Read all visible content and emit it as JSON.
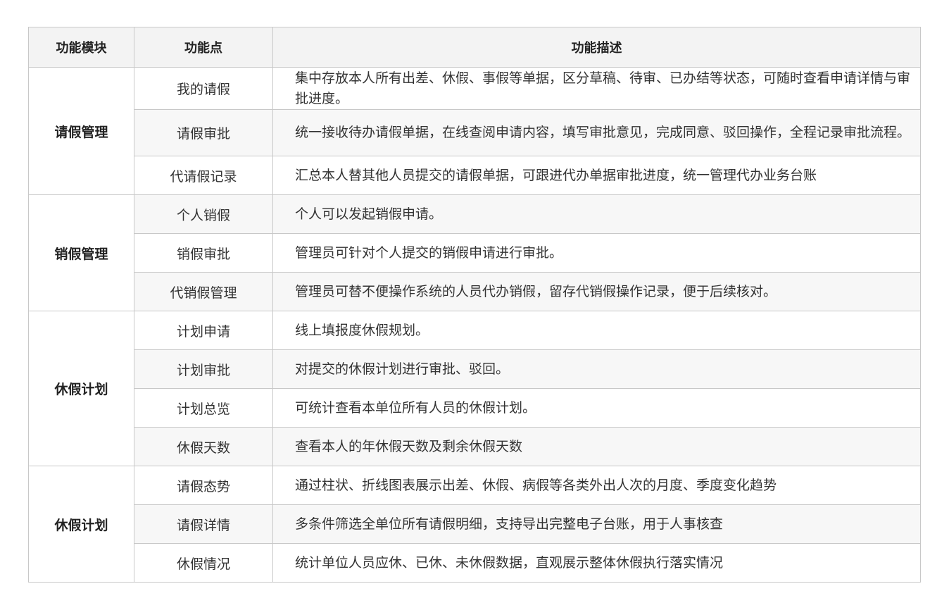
{
  "table": {
    "headers": [
      "功能模块",
      "功能点",
      "功能描述"
    ],
    "groups": [
      {
        "module": "请假管理",
        "rows": [
          {
            "point": "我的请假",
            "desc": "集中存放本人所有出差、休假、事假等单据，区分草稿、待审、已办结等状态，可随时查看申请详情与审批进度。"
          },
          {
            "point": "请假审批",
            "desc": "统一接收待办请假单据，在线查阅申请内容，填写审批意见，完成同意、驳回操作，全程记录审批流程。"
          },
          {
            "point": "代请假记录",
            "desc": "汇总本人替其他人员提交的请假单据，可跟进代办单据审批进度，统一管理代办业务台账"
          }
        ]
      },
      {
        "module": "销假管理",
        "rows": [
          {
            "point": "个人销假",
            "desc": "个人可以发起销假申请。"
          },
          {
            "point": "销假审批",
            "desc": "管理员可针对个人提交的销假申请进行审批。"
          },
          {
            "point": "代销假管理",
            "desc": "管理员可替不便操作系统的人员代办销假，留存代销假操作记录，便于后续核对。"
          }
        ]
      },
      {
        "module": "休假计划",
        "rows": [
          {
            "point": "计划申请",
            "desc": "线上填报度休假规划。"
          },
          {
            "point": "计划审批",
            "desc": "对提交的休假计划进行审批、驳回。"
          },
          {
            "point": "计划总览",
            "desc": "可统计查看本单位所有人员的休假计划。"
          },
          {
            "point": "休假天数",
            "desc": "查看本人的年休假天数及剩余休假天数"
          }
        ]
      },
      {
        "module": "休假计划",
        "rows": [
          {
            "point": "请假态势",
            "desc": "通过柱状、折线图表展示出差、休假、病假等各类外出人次的月度、季度变化趋势"
          },
          {
            "point": "请假详情",
            "desc": "多条件筛选全单位所有请假明细，支持导出完整电子台账，用于人事核查"
          },
          {
            "point": "休假情况",
            "desc": "统计单位人员应休、已休、未休假数据，直观展示整体休假执行落实情况"
          }
        ]
      }
    ]
  }
}
